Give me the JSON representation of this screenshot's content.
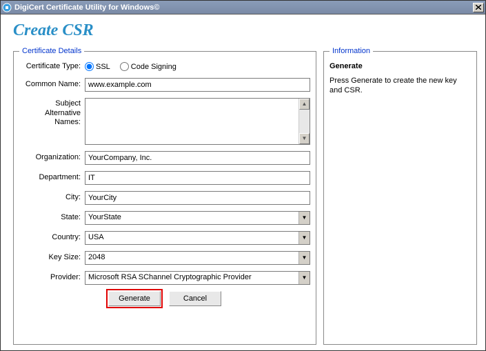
{
  "window": {
    "title": "DigiCert Certificate Utility for Windows©"
  },
  "page": {
    "title": "Create CSR"
  },
  "panels": {
    "details_legend": "Certificate Details",
    "info_legend": "Information"
  },
  "form": {
    "cert_type_label": "Certificate Type:",
    "cert_type_options": {
      "ssl": "SSL",
      "code": "Code Signing"
    },
    "cert_type_value": "ssl",
    "common_name_label": "Common Name:",
    "common_name_value": "www.example.com",
    "san_label": "Subject Alternative Names:",
    "san_value": "",
    "organization_label": "Organization:",
    "organization_value": "YourCompany, Inc.",
    "department_label": "Department:",
    "department_value": "IT",
    "city_label": "City:",
    "city_value": "YourCity",
    "state_label": "State:",
    "state_value": "YourState",
    "country_label": "Country:",
    "country_value": "USA",
    "keysize_label": "Key Size:",
    "keysize_value": "2048",
    "provider_label": "Provider:",
    "provider_value": "Microsoft RSA SChannel Cryptographic Provider"
  },
  "buttons": {
    "generate": "Generate",
    "cancel": "Cancel"
  },
  "info": {
    "title": "Generate",
    "text": "Press Generate to create the new key and CSR."
  }
}
